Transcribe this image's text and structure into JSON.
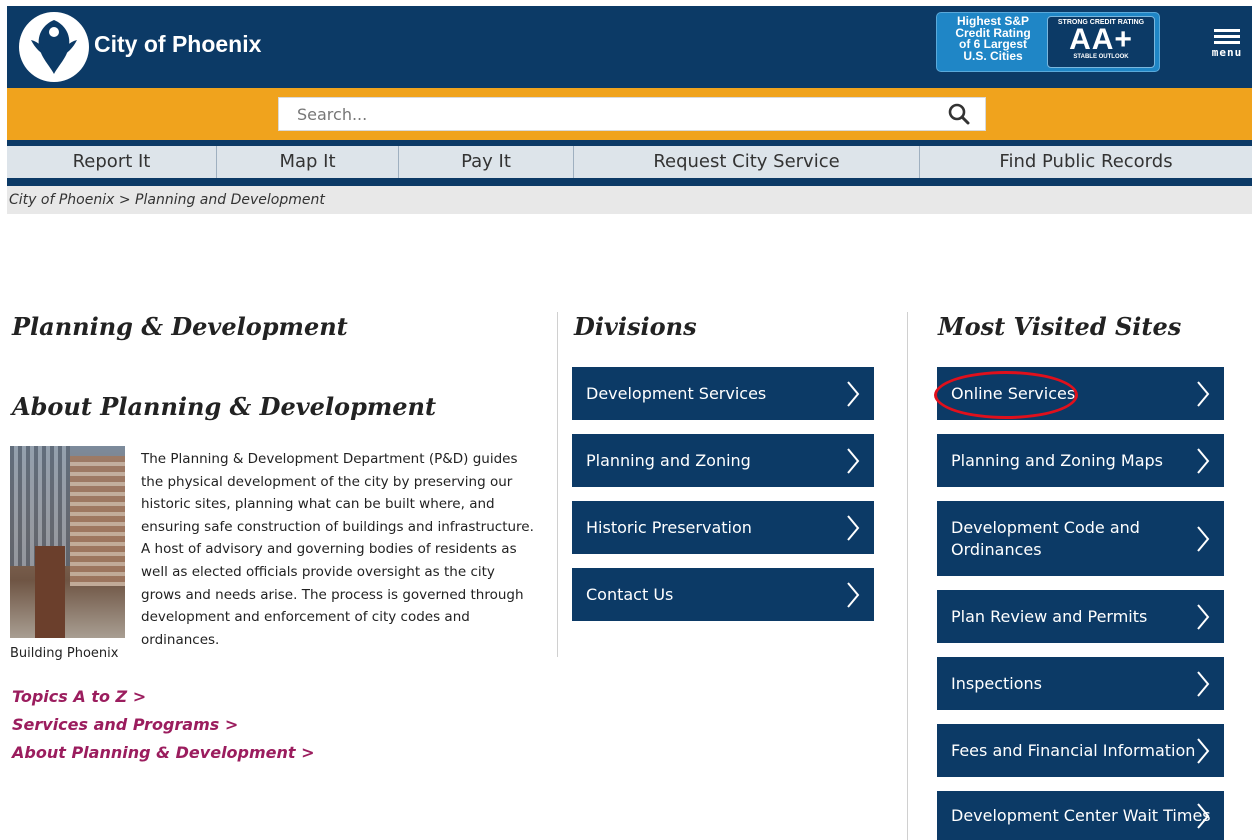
{
  "header": {
    "site_name": "City of Phoenix",
    "badge": {
      "line1": "Highest S&P",
      "line2": "Credit Rating",
      "line3": "of 6 Largest",
      "line4": "U.S. Cities",
      "rating_top": "STRONG CREDIT RATING",
      "rating": "AA+",
      "rating_bottom": "STABLE OUTLOOK"
    },
    "menu_label": "menu",
    "menu_icon": "hamburger-icon",
    "logo_icon": "phoenix-bird-logo"
  },
  "search": {
    "placeholder": "Search...",
    "icon": "magnifier-icon"
  },
  "quicknav": [
    {
      "label": "Report It"
    },
    {
      "label": "Map It"
    },
    {
      "label": "Pay It"
    },
    {
      "label": "Request City Service"
    },
    {
      "label": "Find Public Records"
    }
  ],
  "breadcrumb": {
    "home": "City of Phoenix",
    "separator": " > ",
    "current": "Planning and Development"
  },
  "left": {
    "title": "Planning & Development",
    "about_title": "About Planning & Development",
    "photo_caption": "Building Phoenix",
    "about_text": "The Planning & Development Department (P&D) guides the physical development of the city by preserving our historic sites, planning what can be built where, and ensuring safe construction of buildings and infrastructure. A host of advisory and governing bodies of residents as well as elected officials provide oversight as the city grows and needs arise. The process is governed through development and enforcement of city codes and ordinances.",
    "links": [
      "Topics A to Z  >",
      "Services and Programs >",
      "About Planning & Development >"
    ]
  },
  "divisions": {
    "title": "Divisions",
    "items": [
      "Development Services",
      "Planning and Zoning",
      "Historic Preservation",
      "Contact Us"
    ]
  },
  "most_visited": {
    "title": "Most Visited Sites",
    "items": [
      "Online Services",
      "Planning and Zoning Maps",
      "Development Code and Ordinances",
      "Plan Review and Permits",
      "Inspections",
      "Fees and Financial Information",
      "Development Center Wait Times"
    ],
    "highlight_color": "#e0101c"
  },
  "colors": {
    "navy": "#0c3a66",
    "orange": "#f0a31d",
    "link": "#9b1d5e"
  }
}
